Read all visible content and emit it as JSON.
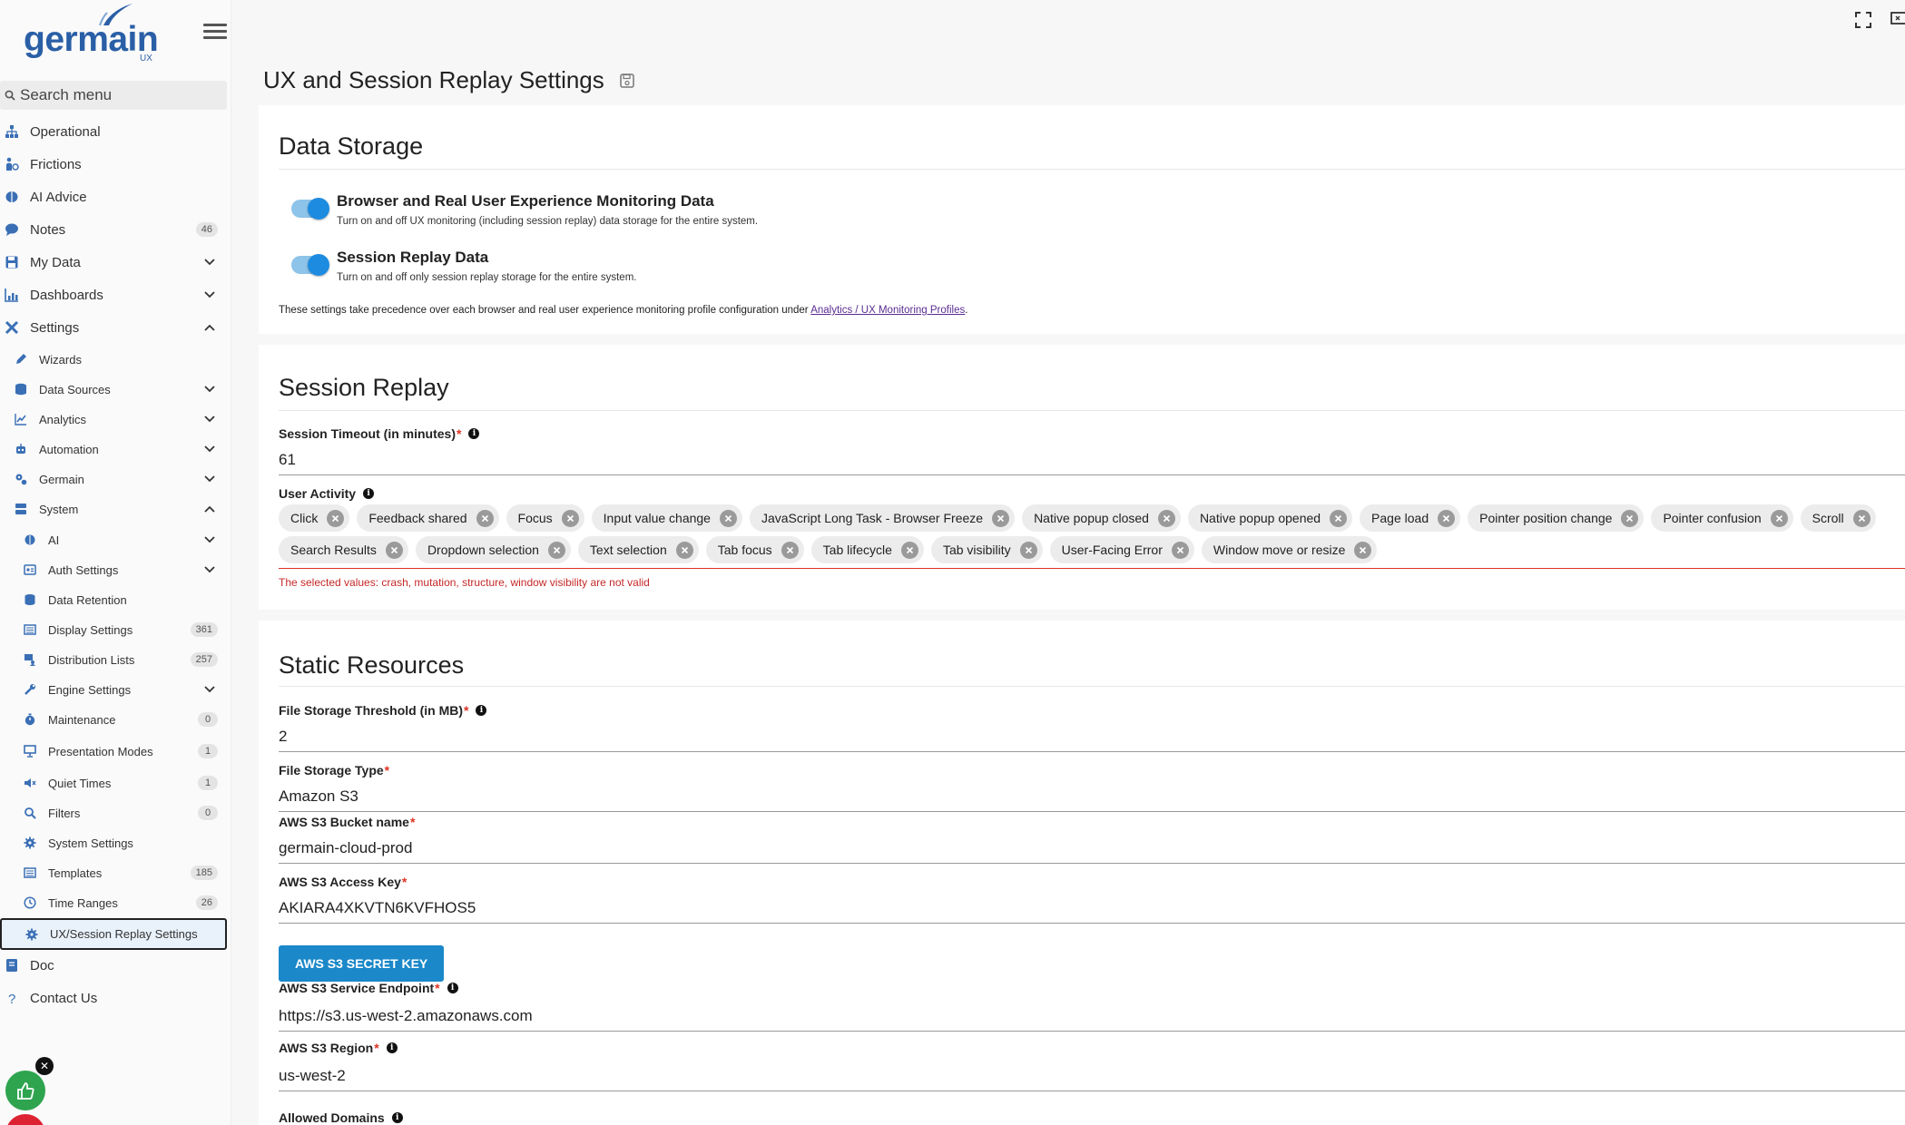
{
  "app": {
    "logo_text": "germain",
    "logo_sub": "UX",
    "page_title": "UX and Session Replay Settings"
  },
  "sidebar": {
    "search_placeholder": "Search menu",
    "items": [
      {
        "label": "Operational",
        "icon": "sitemap-icon"
      },
      {
        "label": "Frictions",
        "icon": "person-frictions-icon"
      },
      {
        "label": "AI Advice",
        "icon": "brain-icon"
      },
      {
        "label": "Notes",
        "icon": "comment-icon",
        "badge": "46"
      },
      {
        "label": "My Data",
        "icon": "save-icon"
      },
      {
        "label": "Dashboards",
        "icon": "chart-icon"
      },
      {
        "label": "Settings",
        "icon": "tools-icon"
      }
    ],
    "settings_children": [
      {
        "label": "Wizards"
      },
      {
        "label": "Data Sources"
      },
      {
        "label": "Analytics"
      },
      {
        "label": "Automation"
      },
      {
        "label": "Germain"
      },
      {
        "label": "System"
      }
    ],
    "system_children": [
      {
        "label": "AI"
      },
      {
        "label": "Auth Settings"
      },
      {
        "label": "Data Retention"
      },
      {
        "label": "Display Settings",
        "badge": "361"
      },
      {
        "label": "Distribution Lists",
        "badge": "257"
      },
      {
        "label": "Engine Settings"
      },
      {
        "label": "Maintenance",
        "badge": "0"
      },
      {
        "label": "Presentation Modes",
        "badge": "1"
      },
      {
        "label": "Quiet Times",
        "badge": "1"
      },
      {
        "label": "Filters",
        "badge": "0"
      },
      {
        "label": "System Settings"
      },
      {
        "label": "Templates",
        "badge": "185"
      },
      {
        "label": "Time Ranges",
        "badge": "26"
      },
      {
        "label": "UX/Session Replay Settings"
      }
    ],
    "footer_items": [
      {
        "label": "Doc"
      },
      {
        "label": "Contact Us"
      }
    ]
  },
  "data_storage": {
    "heading": "Data Storage",
    "toggle1_title": "Browser and Real User Experience Monitoring Data",
    "toggle1_desc": "Turn on and off UX monitoring (including session replay) data storage for the entire system.",
    "toggle2_title": "Session Replay Data",
    "toggle2_desc": "Turn on and off only session replay storage for the entire system.",
    "note_prefix": "These settings take precedence over each browser and real user experience monitoring profile configuration under ",
    "note_link": "Analytics / UX Monitoring Profiles",
    "note_suffix": "."
  },
  "session_replay": {
    "heading": "Session Replay",
    "timeout_label": "Session Timeout (in minutes)",
    "timeout_value": "61",
    "activity_label": "User Activity",
    "chips_row1": [
      "Click",
      "Feedback shared",
      "Focus",
      "Input value change",
      "JavaScript Long Task - Browser Freeze",
      "Native popup closed",
      "Native popup opened",
      "Page load",
      "Pointer position change",
      "Pointer confusion",
      "Scroll"
    ],
    "chips_row2": [
      "Search Results",
      "Dropdown selection",
      "Text selection",
      "Tab focus",
      "Tab lifecycle",
      "Tab visibility",
      "User-Facing Error",
      "Window move or resize"
    ],
    "error": "The selected values: crash, mutation, structure, window visibility are not valid"
  },
  "static_resources": {
    "heading": "Static Resources",
    "threshold_label": "File Storage Threshold (in MB)",
    "threshold_value": "2",
    "type_label": "File Storage Type",
    "type_value": "Amazon S3",
    "bucket_label": "AWS S3 Bucket name",
    "bucket_value": "germain-cloud-prod",
    "access_label": "AWS S3 Access Key",
    "access_value": "AKIARA4XKVTN6KVFHOS5",
    "secret_button": "AWS S3 SECRET KEY",
    "endpoint_label": "AWS S3 Service Endpoint",
    "endpoint_value": "https://s3.us-west-2.amazonaws.com",
    "region_label": "AWS S3 Region",
    "region_value": "us-west-2",
    "domains_label": "Allowed Domains"
  },
  "colors": {
    "brand": "#2a5fa6",
    "accent": "#1a88c9",
    "error": "#d32f2f",
    "feedback": "#2ea44f"
  }
}
